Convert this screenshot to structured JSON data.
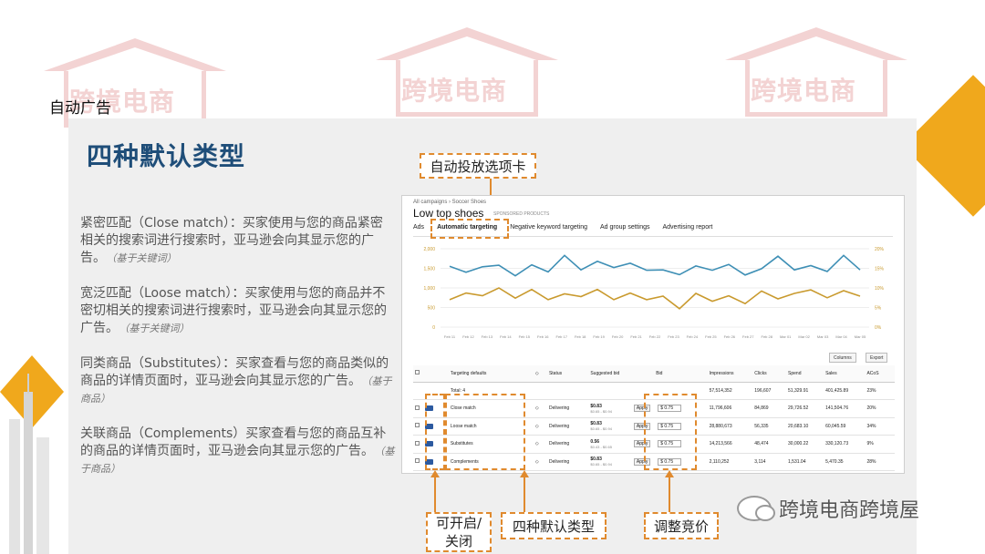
{
  "watermark_text": "跨境电商",
  "slide_label": "自动广告",
  "title": "四种默认类型",
  "descriptions": [
    {
      "heading": "紧密匹配（Close match）",
      "body": "：买家使用与您的商品紧密相关的搜索词进行搜索时，亚马逊会向其显示您的广告。",
      "note": "（基于关键词）"
    },
    {
      "heading": "宽泛匹配（Loose match）",
      "body": "：买家使用与您的商品并不密切相关的搜索词进行搜索时，亚马逊会向其显示您的广告。",
      "note": "（基于关键词）"
    },
    {
      "heading": "同类商品（Substitutes）",
      "body": "：买家查看与您的商品类似的商品的详情页面时，亚马逊会向其显示您的广告。",
      "note": "（基于商品）"
    },
    {
      "heading": "关联商品（Complements）",
      "body": "买家查看与您的商品互补的商品的详情页面时，亚马逊会向其显示您的广告。",
      "note": "（基于商品）"
    }
  ],
  "callouts": {
    "auto_tab": "自动投放选项卡",
    "toggle": "可开启/关闭",
    "types": "四种默认类型",
    "bid": "调整竞价"
  },
  "screenshot": {
    "breadcrumb": "All campaigns › Soccer Shoes",
    "title": "Low top shoes",
    "title_sub": "SPONSORED PRODUCTS",
    "tabs": [
      "Ads",
      "Automatic targeting",
      "Negative keyword targeting",
      "Ad group settings",
      "Advertising report"
    ],
    "columns_btn": "Columns",
    "export_btn": "Export",
    "table_headers": [
      "",
      "",
      "Targeting defaults",
      "",
      "Status",
      "Suggested bid",
      "",
      "Bid",
      "",
      "Impressions",
      "Clicks",
      "Spend",
      "Sales",
      "ACoS"
    ],
    "total_row": {
      "label": "Total: 4",
      "impressions": "57,514,352",
      "clicks": "196,607",
      "spend": "51,329.91",
      "sales": "401,425.89",
      "acos": "23%"
    },
    "rows": [
      {
        "name": "Close match",
        "status": "Delivering",
        "suggested": "$0.83",
        "range": "$0.65 - $0.94",
        "apply": "Apply",
        "bid": "$  0.75",
        "impressions": "11,796,606",
        "clicks": "84,869",
        "spend": "29,726.52",
        "sales": "141,504.76",
        "acos": "20%"
      },
      {
        "name": "Loose match",
        "status": "Delivering",
        "suggested": "$0.83",
        "range": "$0.65 - $0.94",
        "apply": "Apply",
        "bid": "$  0.75",
        "impressions": "28,880,673",
        "clicks": "56,335",
        "spend": "20,683.10",
        "sales": "60,045.59",
        "acos": "34%"
      },
      {
        "name": "Substitutes",
        "status": "Delivering",
        "suggested": "0.56",
        "range": "$0.43 - $0.65",
        "apply": "Apply",
        "bid": "$  0.75",
        "impressions": "14,213,566",
        "clicks": "48,474",
        "spend": "30,000.22",
        "sales": "330,120.73",
        "acos": "9%"
      },
      {
        "name": "Complements",
        "status": "Delivering",
        "suggested": "$0.83",
        "range": "$0.65 - $0.94",
        "apply": "Apply",
        "bid": "$  0.75",
        "impressions": "2,110,252",
        "clicks": "3,114",
        "spend": "1,531.04",
        "sales": "5,470.35",
        "acos": "28%"
      }
    ]
  },
  "brand": "跨境电商跨境屋",
  "colors": {
    "accent": "#e08a2e",
    "title": "#1f4e79",
    "line_blue": "#3e8fb5",
    "line_gold": "#c99a2e",
    "diamond": "#f0a81c"
  },
  "chart_data": {
    "type": "line",
    "x": [
      "Feb 11",
      "Feb 12",
      "Feb 13",
      "Feb 14",
      "Feb 15",
      "Feb 16",
      "Feb 17",
      "Feb 18",
      "Feb 19",
      "Feb 20",
      "Feb 21",
      "Feb 22",
      "Feb 23",
      "Feb 24",
      "Feb 25",
      "Feb 26",
      "Feb 27",
      "Feb 28",
      "Mar 01",
      "Mar 02",
      "Mar 03",
      "Mar 04",
      "Mar 05"
    ],
    "yticks_left": [
      "2,000",
      "1,500",
      "1,000",
      "500",
      "0"
    ],
    "yticks_right": [
      "20%",
      "15%",
      "10%",
      "5%",
      "0%"
    ],
    "ylim": [
      0,
      2000
    ],
    "series": [
      {
        "values": [
          1550,
          1400,
          1540,
          1580,
          1310,
          1590,
          1410,
          1830,
          1460,
          1680,
          1520,
          1630,
          1450,
          1460,
          1340,
          1560,
          1450,
          1600,
          1330,
          1490,
          1810,
          1460,
          1570,
          1420,
          1830,
          1460
        ]
      },
      {
        "values": [
          700,
          870,
          800,
          1000,
          740,
          960,
          700,
          850,
          780,
          960,
          700,
          870,
          700,
          790,
          470,
          860,
          660,
          800,
          600,
          920,
          720,
          860,
          950,
          750,
          930,
          790
        ]
      }
    ]
  }
}
